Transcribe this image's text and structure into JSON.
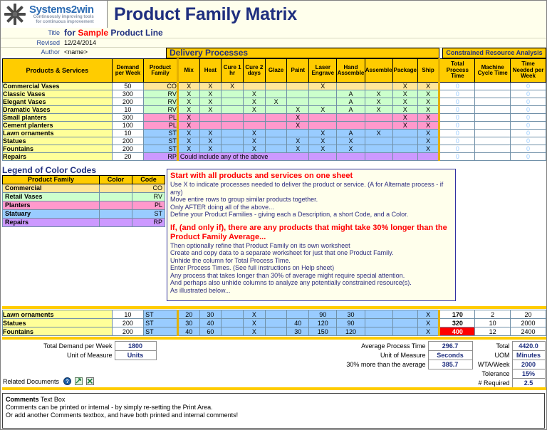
{
  "brand": {
    "name": "Systems2win",
    "tagline1": "Continuously improving tools",
    "tagline2": "for continuous improvement",
    "logo_icon": "starburst-icon"
  },
  "header": {
    "title": "Product Family Matrix",
    "meta": [
      {
        "label": "Title",
        "value_prefix": "for ",
        "value_hl": "Sample",
        "value_suffix": " Product Line"
      },
      {
        "label": "Revised",
        "value": "12/24/2014"
      },
      {
        "label": "Author",
        "value": "<name>"
      }
    ],
    "delivery_processes_band": "Delivery Processes",
    "constrained_band": "Constrained Resource Analysis"
  },
  "matrix": {
    "col_products": "Products & Services",
    "col_demand": "Demand per Week",
    "col_family": "Product Family",
    "processes": [
      "Mix",
      "Heat",
      "Cure 1 hr",
      "Cure 2 days",
      "Glaze",
      "Paint",
      "Laser Engrave",
      "Hand Assemble",
      "Assemble",
      "Package",
      "Ship"
    ],
    "cra_columns": [
      "Total Process Time",
      "Machine Cycle Time",
      "Time Needed per Week"
    ],
    "rows": [
      {
        "name": "Commercial Vases",
        "demand": "50",
        "family": "CO",
        "cells": [
          "X",
          "X",
          "X",
          "",
          "",
          "",
          "X",
          "",
          "",
          "X",
          "X"
        ],
        "total": "0",
        "machine": "",
        "week": "0"
      },
      {
        "name": "Classic Vases",
        "demand": "300",
        "family": "RV",
        "cells": [
          "X",
          "X",
          "",
          "X",
          "",
          "",
          "",
          "A",
          "X",
          "X",
          "X"
        ],
        "total": "0",
        "machine": "",
        "week": "0"
      },
      {
        "name": "Elegant Vases",
        "demand": "200",
        "family": "RV",
        "cells": [
          "X",
          "X",
          "",
          "X",
          "X",
          "",
          "",
          "A",
          "X",
          "X",
          "X"
        ],
        "total": "0",
        "machine": "",
        "week": "0"
      },
      {
        "name": "Dramatic Vases",
        "demand": "10",
        "family": "RV",
        "cells": [
          "X",
          "X",
          "",
          "X",
          "",
          "X",
          "X",
          "A",
          "X",
          "X",
          "X"
        ],
        "total": "0",
        "machine": "",
        "week": "0"
      },
      {
        "name": "Small planters",
        "demand": "300",
        "family": "PL",
        "cells": [
          "X",
          "",
          "",
          "",
          "",
          "X",
          "",
          "",
          "",
          "X",
          "X"
        ],
        "total": "0",
        "machine": "",
        "week": "0"
      },
      {
        "name": "Cement planters",
        "demand": "100",
        "family": "PL",
        "cells": [
          "X",
          "",
          "",
          "",
          "",
          "X",
          "",
          "",
          "",
          "X",
          "X"
        ],
        "total": "0",
        "machine": "",
        "week": "0"
      },
      {
        "name": "Lawn ornaments",
        "demand": "10",
        "family": "ST",
        "cells": [
          "X",
          "X",
          "",
          "X",
          "",
          "",
          "X",
          "A",
          "X",
          "",
          "X"
        ],
        "total": "0",
        "machine": "",
        "week": "0"
      },
      {
        "name": "Statues",
        "demand": "200",
        "family": "ST",
        "cells": [
          "X",
          "X",
          "",
          "X",
          "",
          "X",
          "X",
          "X",
          "",
          "",
          "X"
        ],
        "total": "0",
        "machine": "",
        "week": "0"
      },
      {
        "name": "Fountains",
        "demand": "200",
        "family": "ST",
        "cells": [
          "X",
          "X",
          "",
          "X",
          "",
          "X",
          "X",
          "X",
          "",
          "",
          "X"
        ],
        "total": "0",
        "machine": "",
        "week": "0"
      },
      {
        "name": "Repairs",
        "demand": "20",
        "family": "RP",
        "span_note": "Could include any of the above",
        "total": "0",
        "machine": "",
        "week": "0"
      }
    ]
  },
  "legend": {
    "title": "Legend of Color Codes",
    "headers": [
      "Product Family",
      "Color",
      "Code"
    ],
    "rows": [
      {
        "family": "Commercial",
        "code": "CO",
        "color": "#FFE699"
      },
      {
        "family": "Retail Vases",
        "code": "RV",
        "color": "#CCFFCC"
      },
      {
        "family": "Planters",
        "code": "PL",
        "color": "#FF99CC"
      },
      {
        "family": "Statuary",
        "code": "ST",
        "color": "#99CCFF"
      },
      {
        "family": "Repairs",
        "code": "RP",
        "color": "#CC99FF"
      }
    ]
  },
  "instructions": {
    "heading1": "Start with all products and services on one sheet",
    "lines1": [
      "Use X to indicate processes needed to deliver the product or service. (A for Alternate process - if any)",
      "Move entire rows to group similar products together.",
      "Only AFTER doing all of the above...",
      "Define your Product Families  - giving each a Description, a short Code, and a Color."
    ],
    "heading2a": "If, (and only if), there are any products that might take 30% longer than the",
    "heading2b": "Product Family Average...",
    "lines2": [
      "Then optionally refine that Product Family on its own worksheet",
      "Create and copy data to a separate worksheet for just that one Product Family.",
      "Unhide the column for Total Process Time.",
      "Enter Process Times.  (See full instructions on Help sheet)",
      "Any process that takes longer than 30% of average might require special attention.",
      "And perhaps also unhide columns to analyze any potentially constrained resource(s).",
      "As illustrated below..."
    ]
  },
  "example": {
    "rows": [
      {
        "name": "Lawn ornaments",
        "demand": "10",
        "family": "ST",
        "cells": [
          "20",
          "30",
          "",
          "X",
          "",
          "",
          "90",
          "30",
          "",
          "",
          "X"
        ],
        "total": "170",
        "machine": "2",
        "week": "20",
        "highlight": false
      },
      {
        "name": "Statues",
        "demand": "200",
        "family": "ST",
        "cells": [
          "30",
          "40",
          "",
          "X",
          "",
          "40",
          "120",
          "90",
          "",
          "",
          "X"
        ],
        "total": "320",
        "machine": "10",
        "week": "2000",
        "highlight": false
      },
      {
        "name": "Fountains",
        "demand": "200",
        "family": "ST",
        "cells": [
          "40",
          "60",
          "",
          "X",
          "",
          "30",
          "150",
          "120",
          "",
          "",
          "X"
        ],
        "total": "400",
        "machine": "12",
        "week": "2400",
        "highlight": true
      }
    ],
    "highlight_color": "#FF0000"
  },
  "totals": {
    "left": [
      {
        "label": "Total Demand per Week",
        "value": "1800"
      },
      {
        "label": "Unit of Measure",
        "value": "Units"
      }
    ],
    "middle": [
      {
        "label": "Average Process Time",
        "value": "296.7"
      },
      {
        "label": "Unit of Measure",
        "value": "Seconds"
      },
      {
        "label": "30% more than the average",
        "value": "385.7"
      }
    ],
    "right": [
      {
        "label": "Total",
        "value": "4420.0"
      },
      {
        "label": "UOM",
        "value": "Minutes"
      },
      {
        "label": "WTA/Week",
        "value": "2000"
      },
      {
        "label": "Tolerance",
        "value": "15%"
      },
      {
        "label": "# Required",
        "value": "2.5"
      }
    ]
  },
  "related_documents": {
    "label": "Related Documents",
    "icons": [
      "help-icon",
      "link-icon",
      "excel-icon"
    ]
  },
  "comments": {
    "title_b": "Comments",
    "title_rest": " Text Box",
    "line1": "Comments  can be printed or internal - by simply re-setting the Print Area.",
    "line2": "Or add another Comments  textbox, and have both printed and internal comments!"
  },
  "colors": {
    "header_gold": "#FFCC00",
    "name_yellow": "#FFFF99",
    "navy": "#1F2F7F",
    "accent_red": "#FF0000",
    "cream": "#FFFFEC"
  }
}
